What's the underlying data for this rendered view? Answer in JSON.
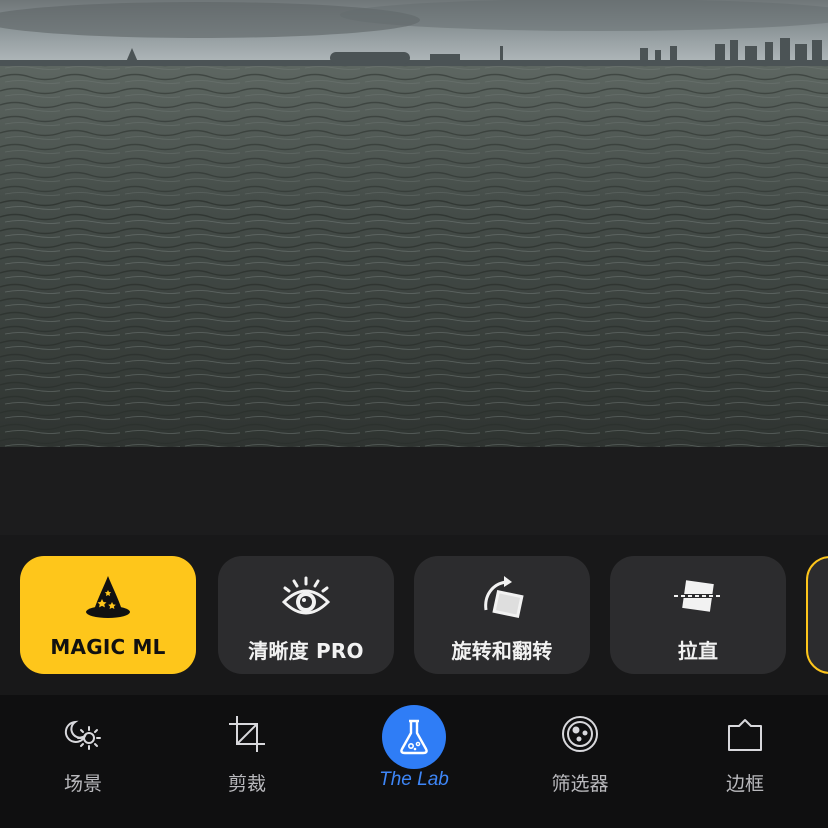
{
  "photo": {
    "subject": "sea-and-city-skyline"
  },
  "tools": [
    {
      "label": "MAGIC ML",
      "icon": "wizard-hat-icon",
      "active": true
    },
    {
      "label": "清晰度 PRO",
      "icon": "eye-icon",
      "active": false
    },
    {
      "label": "旋转和翻转",
      "icon": "rotate-icon",
      "active": false
    },
    {
      "label": "拉直",
      "icon": "straighten-icon",
      "active": false
    }
  ],
  "tabs": [
    {
      "label": "场景",
      "icon": "scene-icon"
    },
    {
      "label": "剪裁",
      "icon": "crop-icon"
    },
    {
      "label": "The Lab",
      "icon": "flask-icon",
      "active": true
    },
    {
      "label": "筛选器",
      "icon": "filter-icon"
    },
    {
      "label": "边框",
      "icon": "frame-icon"
    }
  ],
  "colors": {
    "accent": "#fec61b",
    "tab_active": "#2f7df6",
    "tab_active_label": "#3e86f7"
  }
}
